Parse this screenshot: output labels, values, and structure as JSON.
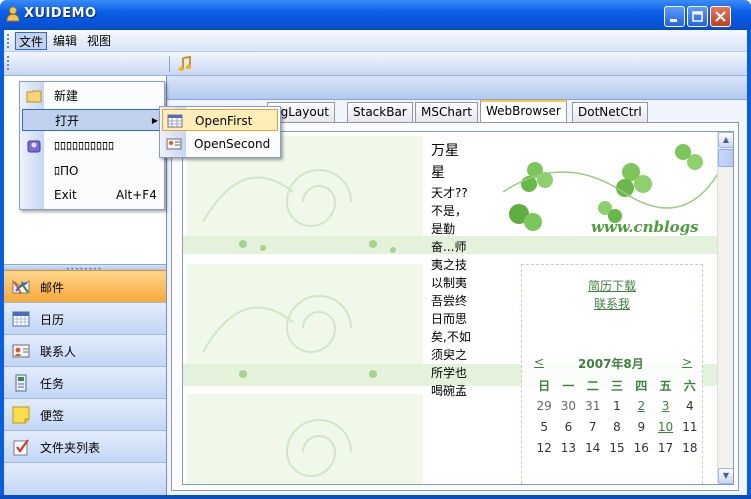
{
  "window": {
    "title": "XUIDEMO"
  },
  "menubar": {
    "items": [
      "文件",
      "编辑",
      "视图"
    ]
  },
  "file_menu": {
    "items": [
      {
        "label": "新建",
        "shortcut": "",
        "icon": "folder-icon",
        "has_submenu": false
      },
      {
        "label": "打开",
        "shortcut": "",
        "icon": "",
        "has_submenu": true
      },
      {
        "label": "ﾛﾛﾛﾛﾛﾛﾛﾛﾛﾛ",
        "shortcut": "",
        "icon": "users-icon",
        "has_submenu": false
      },
      {
        "label": "ﾛПО",
        "shortcut": "",
        "icon": "",
        "has_submenu": false
      },
      {
        "label": "Exit",
        "shortcut": "Alt+F4",
        "icon": "",
        "has_submenu": false
      }
    ]
  },
  "open_submenu": {
    "items": [
      {
        "label": "OpenFirst",
        "icon": "grid-icon"
      },
      {
        "label": "OpenSecond",
        "icon": "form-icon"
      }
    ]
  },
  "nav": {
    "items": [
      {
        "label": "邮件",
        "icon": "mail-icon",
        "active": true
      },
      {
        "label": "日历",
        "icon": "calendar-icon",
        "active": false
      },
      {
        "label": "联系人",
        "icon": "contacts-icon",
        "active": false
      },
      {
        "label": "任务",
        "icon": "tasks-icon",
        "active": false
      },
      {
        "label": "便签",
        "icon": "notes-icon",
        "active": false
      },
      {
        "label": "文件夹列表",
        "icon": "folder-list-icon",
        "active": false
      }
    ]
  },
  "tabs": {
    "items": [
      {
        "label": "ngLayout",
        "active": false
      },
      {
        "label": "StackBar",
        "active": false
      },
      {
        "label": "MSChart",
        "active": false
      },
      {
        "label": "WebBrowser",
        "active": true
      },
      {
        "label": "DotNetCtrl",
        "active": false
      }
    ]
  },
  "browser": {
    "article_title": "万星星",
    "article_body": "天才??不是，是勤奋...师夷之技以制夷 吾尝终日而思矣,不如须臾之所学也 喝碗孟",
    "logo_text": "www.cnblogs",
    "links": [
      "简历下载",
      "联系我"
    ],
    "calendar": {
      "prev": "<",
      "month": "2007年8月",
      "next": ">",
      "weekdays": [
        "日",
        "一",
        "二",
        "三",
        "四",
        "五",
        "六"
      ],
      "rows": [
        [
          {
            "d": "29",
            "other": true,
            "link": false
          },
          {
            "d": "30",
            "other": true,
            "link": false
          },
          {
            "d": "31",
            "other": true,
            "link": false
          },
          {
            "d": "1",
            "other": false,
            "link": false
          },
          {
            "d": "2",
            "other": false,
            "link": true
          },
          {
            "d": "3",
            "other": false,
            "link": true
          },
          {
            "d": "4",
            "other": false,
            "link": false
          }
        ],
        [
          {
            "d": "5",
            "other": false,
            "link": false
          },
          {
            "d": "6",
            "other": false,
            "link": false
          },
          {
            "d": "7",
            "other": false,
            "link": false
          },
          {
            "d": "8",
            "other": false,
            "link": false
          },
          {
            "d": "9",
            "other": false,
            "link": false
          },
          {
            "d": "10",
            "other": false,
            "link": true
          },
          {
            "d": "11",
            "other": false,
            "link": false
          }
        ],
        [
          {
            "d": "12",
            "other": false,
            "link": false
          },
          {
            "d": "13",
            "other": false,
            "link": false
          },
          {
            "d": "14",
            "other": false,
            "link": false
          },
          {
            "d": "15",
            "other": false,
            "link": false
          },
          {
            "d": "16",
            "other": false,
            "link": false
          },
          {
            "d": "17",
            "other": false,
            "link": false
          },
          {
            "d": "18",
            "other": false,
            "link": false
          }
        ]
      ]
    }
  },
  "colors": {
    "titlebar": "#0b5fe8",
    "accent_orange": "#f7a93a",
    "link_green": "#3f7f3f",
    "menu_highlight": "#c1d2ee",
    "submenu_highlight": "#ffeeb8"
  }
}
